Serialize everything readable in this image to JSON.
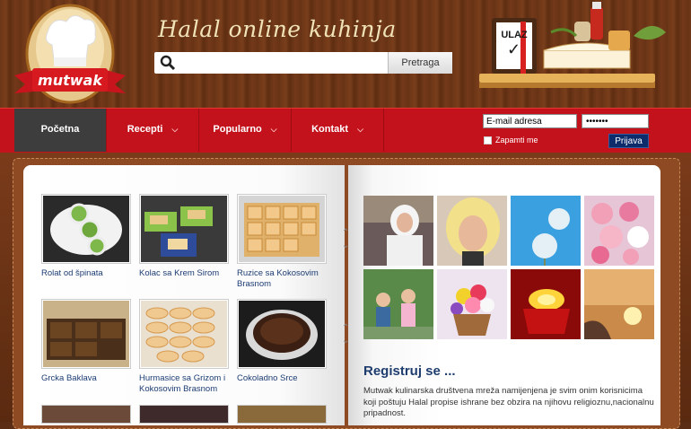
{
  "header": {
    "logo_text": "mutwak",
    "site_title": "Halal online kuhinja",
    "search_placeholder": "",
    "search_button": "Pretraga",
    "ulaz_sign": "ULAZ"
  },
  "nav": {
    "items": [
      {
        "label": "Početna",
        "active": true,
        "has_dropdown": false
      },
      {
        "label": "Recepti",
        "active": false,
        "has_dropdown": true
      },
      {
        "label": "Popularno",
        "active": false,
        "has_dropdown": true
      },
      {
        "label": "Kontakt",
        "active": false,
        "has_dropdown": true
      }
    ]
  },
  "login": {
    "email_value": "E-mail adresa",
    "password_value": "•••••••",
    "remember_label": "Zapamti me",
    "submit_label": "Prijava"
  },
  "recipes": [
    {
      "title": "Rolat od špinata",
      "icon": "spinach-roll-photo"
    },
    {
      "title": "Kolac sa Krem Sirom",
      "icon": "cream-cake-photo"
    },
    {
      "title": "Ruzice sa Kokosovim Brasnom",
      "icon": "coconut-pastry-photo"
    },
    {
      "title": "Grcka Baklava",
      "icon": "baklava-photo"
    },
    {
      "title": "Hurmasice sa Grizom i Kokosovim Brasnom",
      "icon": "hurmasice-photo"
    },
    {
      "title": "Cokoladno Srce",
      "icon": "chocolate-heart-photo"
    }
  ],
  "gallery": [
    {
      "icon": "woman-hijab-photo"
    },
    {
      "icon": "blonde-portrait-photo"
    },
    {
      "icon": "dandelion-photo"
    },
    {
      "icon": "flowers-photo"
    },
    {
      "icon": "children-photo"
    },
    {
      "icon": "flower-basket-photo"
    },
    {
      "icon": "red-candle-photo"
    },
    {
      "icon": "sunset-hands-photo"
    }
  ],
  "register": {
    "title": "Registruj se ...",
    "text": "Mutwak kulinarska društvena mreža namijenjena je svim onim korisnicima koji poštuju Halal propise ishrane bez obzira na njihovu religioznu,nacionalnu pripadnost."
  },
  "colors": {
    "nav_red": "#c4121c",
    "nav_active": "#3d3d3d",
    "link_blue": "#1c3c73",
    "title_cream": "#f1e3b8"
  }
}
